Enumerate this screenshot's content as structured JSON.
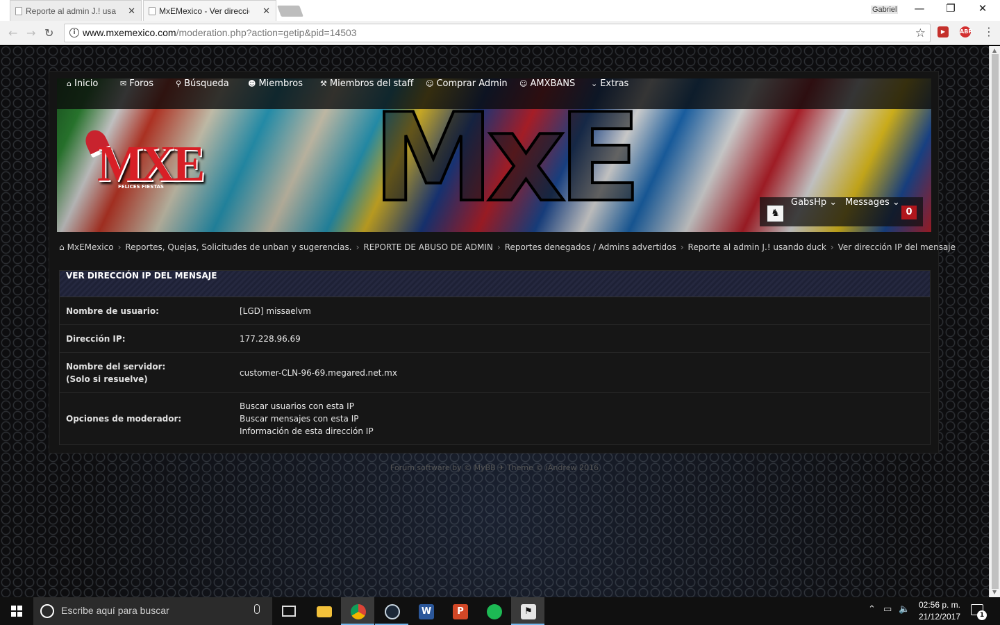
{
  "browser": {
    "tabs": [
      {
        "label": "Reporte al admin J.! usan",
        "active": false
      },
      {
        "label": "MxEMexico - Ver direcció",
        "active": true
      }
    ],
    "profile": "Gabriel",
    "url_host": "www.mxemexico.com",
    "url_path": "/moderation.php?action=getip&pid=14503",
    "extensions": [
      {
        "icon": "video-ext-icon",
        "label": "",
        "color": "#c4302b"
      },
      {
        "icon": "adblock-plus-icon",
        "label": "ABP",
        "color": "#d32f2f"
      }
    ]
  },
  "site": {
    "nav": [
      {
        "icon": "home-icon",
        "glyph": "⌂",
        "label": "Inicio"
      },
      {
        "icon": "chat-icon",
        "glyph": "💬",
        "label": "Foros"
      },
      {
        "icon": "search-icon",
        "glyph": "⚲",
        "label": "Búsqueda"
      },
      {
        "icon": "users-icon",
        "glyph": "👥",
        "label": "Miembros"
      },
      {
        "icon": "gavel-icon",
        "glyph": "⚒",
        "label": "Miembros del staff"
      },
      {
        "icon": "user-icon",
        "glyph": "👤",
        "label": "Comprar Admin"
      },
      {
        "icon": "user-plus-icon",
        "glyph": "👤",
        "label": "AMXBANS"
      },
      {
        "icon": "chevron-down-icon",
        "glyph": "⌄",
        "label": "Extras"
      }
    ],
    "logo_small": "MXE",
    "logo_small_tag": "FELICES FIESTAS",
    "logo_big": "MxE",
    "user": {
      "name": "GabsHp",
      "messages_label": "Messages",
      "messages_count": "0"
    },
    "breadcrumb": [
      "MxEMexico",
      "Reportes, Quejas, Solicitudes de unban y sugerencias.",
      "REPORTE DE ABUSO DE ADMIN",
      "Reportes denegados / Admins advertidos",
      "Reporte al admin J.! usando duck",
      "Ver dirección IP del mensaje"
    ],
    "panel": {
      "title": "VER DIRECCIÓN IP DEL MENSAJE",
      "rows": [
        {
          "label": "Nombre de usuario:",
          "value": "[LGD] missaelvm"
        },
        {
          "label": "Dirección IP:",
          "value": "177.228.96.69"
        },
        {
          "label_line1": "Nombre del servidor:",
          "label_line2": "(Solo si resuelve)",
          "value": "customer-CLN-96-69.megared.net.mx"
        },
        {
          "label": "Opciones de moderador:",
          "options": [
            "Buscar usuarios con esta IP",
            "Buscar mensajes con esta IP",
            "Información de esta dirección IP"
          ]
        }
      ]
    },
    "footer": "Forum software by © MyBB  ✈  Theme © iAndrew 2016"
  },
  "taskbar": {
    "search_placeholder": "Escribe aquí para buscar",
    "apps": [
      {
        "name": "task-view-icon",
        "color": "#101010"
      },
      {
        "name": "file-explorer-icon",
        "color": "#f3c13a"
      },
      {
        "name": "chrome-icon",
        "color": "#4caf50"
      },
      {
        "name": "steam-icon",
        "color": "#1b2838"
      },
      {
        "name": "word-icon",
        "color": "#2b579a"
      },
      {
        "name": "powerpoint-icon",
        "color": "#d24726"
      },
      {
        "name": "spotify-icon",
        "color": "#1db954"
      },
      {
        "name": "counter-strike-icon",
        "color": "#e6e6e6"
      }
    ],
    "time": "02:56 p. m.",
    "date": "21/12/2017",
    "notification_count": "1"
  }
}
